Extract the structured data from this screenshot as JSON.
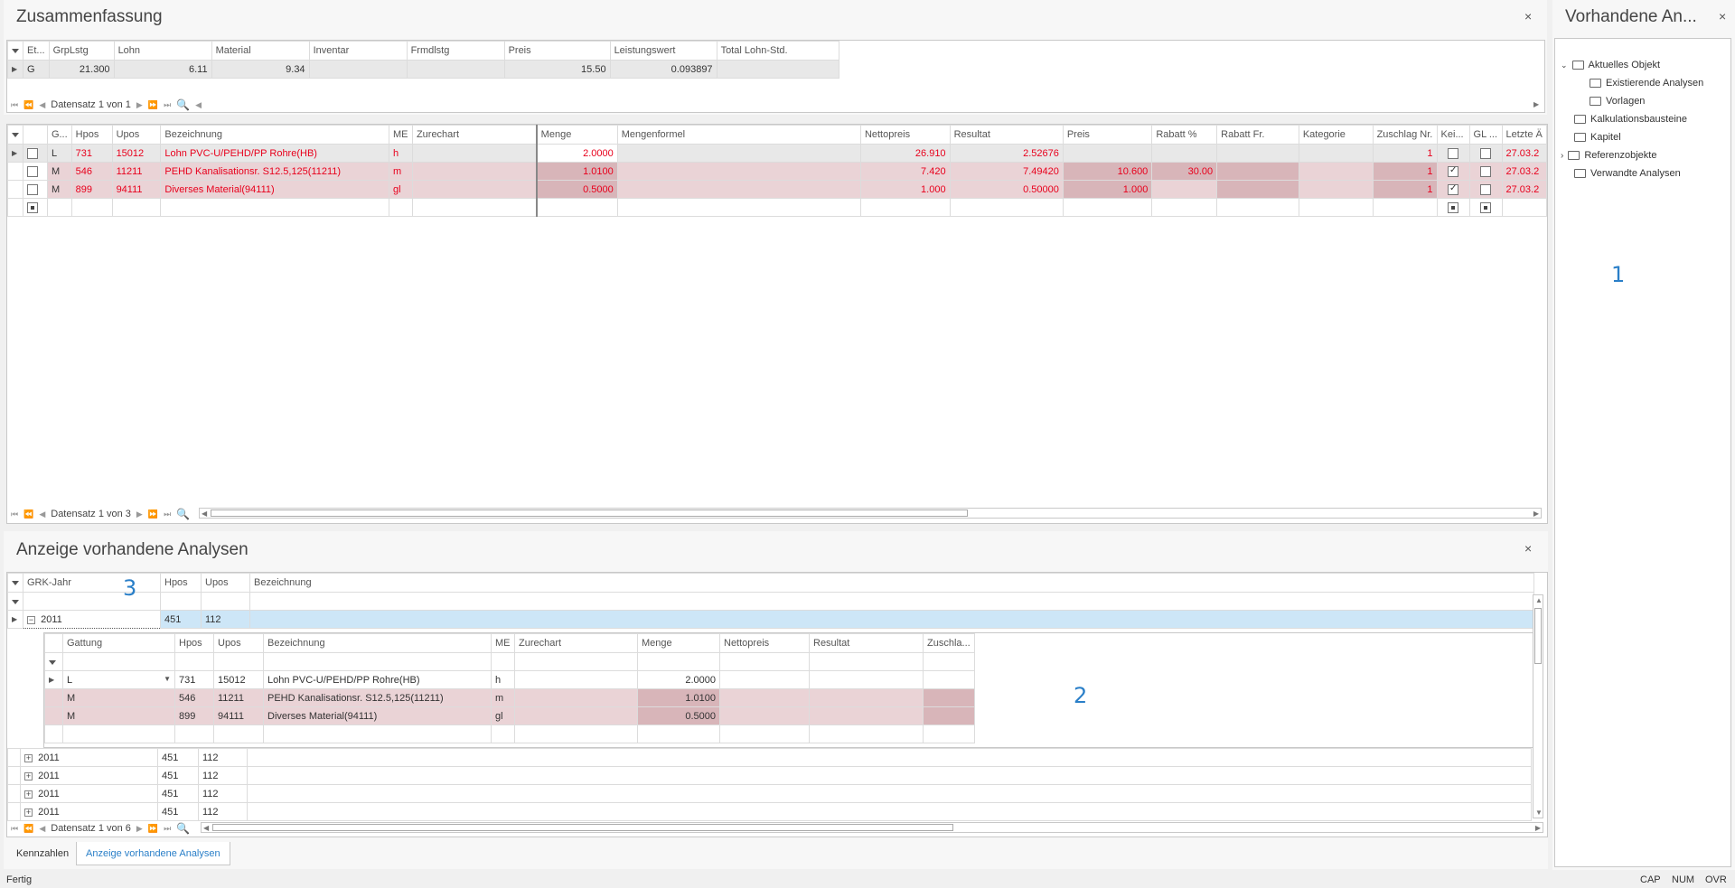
{
  "summary": {
    "title": "Zusammenfassung",
    "close_icon": "×",
    "columns": [
      "Et...",
      "GrpLstg",
      "Lohn",
      "Material",
      "Inventar",
      "Frmdlstg",
      "Preis",
      "Leistungswert",
      "Total Lohn-Std."
    ],
    "row": [
      "G",
      "21.300",
      "6.11",
      "9.34",
      "",
      "",
      "15.50",
      "0.093897",
      ""
    ],
    "nav_text": "Datensatz 1 von 1"
  },
  "detail": {
    "columns": [
      "G...",
      "Hpos",
      "Upos",
      "Bezeichnung",
      "ME",
      "Zurechart",
      "Menge",
      "Mengenformel",
      "Nettopreis",
      "Resultat",
      "Preis",
      "Rabatt %",
      "Rabatt Fr.",
      "Kategorie",
      "Zuschlag Nr.",
      "Kei...",
      "GL ...",
      "Letzte Ä"
    ],
    "rows": [
      {
        "g": "L",
        "hpos": "731",
        "upos": "15012",
        "bez": "Lohn PVC-U/PEHD/PP Rohre(HB)",
        "me": "h",
        "zurechart": "",
        "menge": "2.0000",
        "formel": "",
        "netto": "26.910",
        "resultat": "2.52676",
        "preis": "",
        "rabatt": "",
        "rabattfr": "",
        "kategorie": "",
        "zuschlag": "1",
        "date": "27.03.2"
      },
      {
        "g": "M",
        "hpos": "546",
        "upos": "11211",
        "bez": "PEHD Kanalisationsr. S12.5,125(11211)",
        "me": "m",
        "zurechart": "",
        "menge": "1.0100",
        "formel": "",
        "netto": "7.420",
        "resultat": "7.49420",
        "preis": "10.600",
        "rabatt": "30.00",
        "rabattfr": "",
        "kategorie": "",
        "zuschlag": "1",
        "date": "27.03.2"
      },
      {
        "g": "M",
        "hpos": "899",
        "upos": "94111",
        "bez": "Diverses Material(94111)",
        "me": "gl",
        "zurechart": "",
        "menge": "0.5000",
        "formel": "",
        "netto": "1.000",
        "resultat": "0.50000",
        "preis": "1.000",
        "rabatt": "",
        "rabattfr": "",
        "kategorie": "",
        "zuschlag": "1",
        "date": "27.03.2"
      }
    ],
    "nav_text": "Datensatz 1 von 3"
  },
  "analysen": {
    "title": "Anzeige vorhandene Analysen",
    "close_icon": "×",
    "columns": [
      "GRK-Jahr",
      "Hpos",
      "Upos",
      "Bezeichnung"
    ],
    "first_row": {
      "jahr": "2011",
      "hpos": "451",
      "upos": "112"
    },
    "sub_columns": [
      "Gattung",
      "Hpos",
      "Upos",
      "Bezeichnung",
      "ME",
      "Zurechart",
      "Menge",
      "Nettopreis",
      "Resultat",
      "Zuschla..."
    ],
    "sub_rows": [
      {
        "g": "L",
        "hpos": "731",
        "upos": "15012",
        "bez": "Lohn PVC-U/PEHD/PP Rohre(HB)",
        "me": "h",
        "menge": "2.0000"
      },
      {
        "g": "M",
        "hpos": "546",
        "upos": "11211",
        "bez": "PEHD Kanalisationsr. S12.5,125(11211)",
        "me": "m",
        "menge": "1.0100"
      },
      {
        "g": "M",
        "hpos": "899",
        "upos": "94111",
        "bez": "Diverses Material(94111)",
        "me": "gl",
        "menge": "0.5000"
      }
    ],
    "other_rows": [
      {
        "jahr": "2011",
        "hpos": "451",
        "upos": "112"
      },
      {
        "jahr": "2011",
        "hpos": "451",
        "upos": "112"
      },
      {
        "jahr": "2011",
        "hpos": "451",
        "upos": "112"
      },
      {
        "jahr": "2011",
        "hpos": "451",
        "upos": "112"
      }
    ],
    "nav_text": "Datensatz 1 von 6"
  },
  "tabs": [
    "Kennzahlen",
    "Anzeige vorhandene Analysen"
  ],
  "sidepanel": {
    "title": "Vorhandene An...",
    "close_icon": "×",
    "tree": [
      {
        "label": "Aktuelles Objekt",
        "level": 0,
        "expanded": true
      },
      {
        "label": "Existierende Analysen",
        "level": 1
      },
      {
        "label": "Vorlagen",
        "level": 1
      },
      {
        "label": "Kalkulationsbausteine",
        "level": 0
      },
      {
        "label": "Kapitel",
        "level": 0
      },
      {
        "label": "Referenzobjekte",
        "level": 0,
        "collapsed": true
      },
      {
        "label": "Verwandte Analysen",
        "level": 0
      }
    ]
  },
  "markers": {
    "one": "1",
    "two": "2",
    "three": "3"
  },
  "status": {
    "left": "Fertig",
    "cap": "CAP",
    "num": "NUM",
    "ovr": "OVR"
  },
  "colors": {
    "accent": "#2a7fc8",
    "red_text": "#e8001c",
    "pink_row": "#ead3d6",
    "selected_row": "#cde6f7"
  }
}
